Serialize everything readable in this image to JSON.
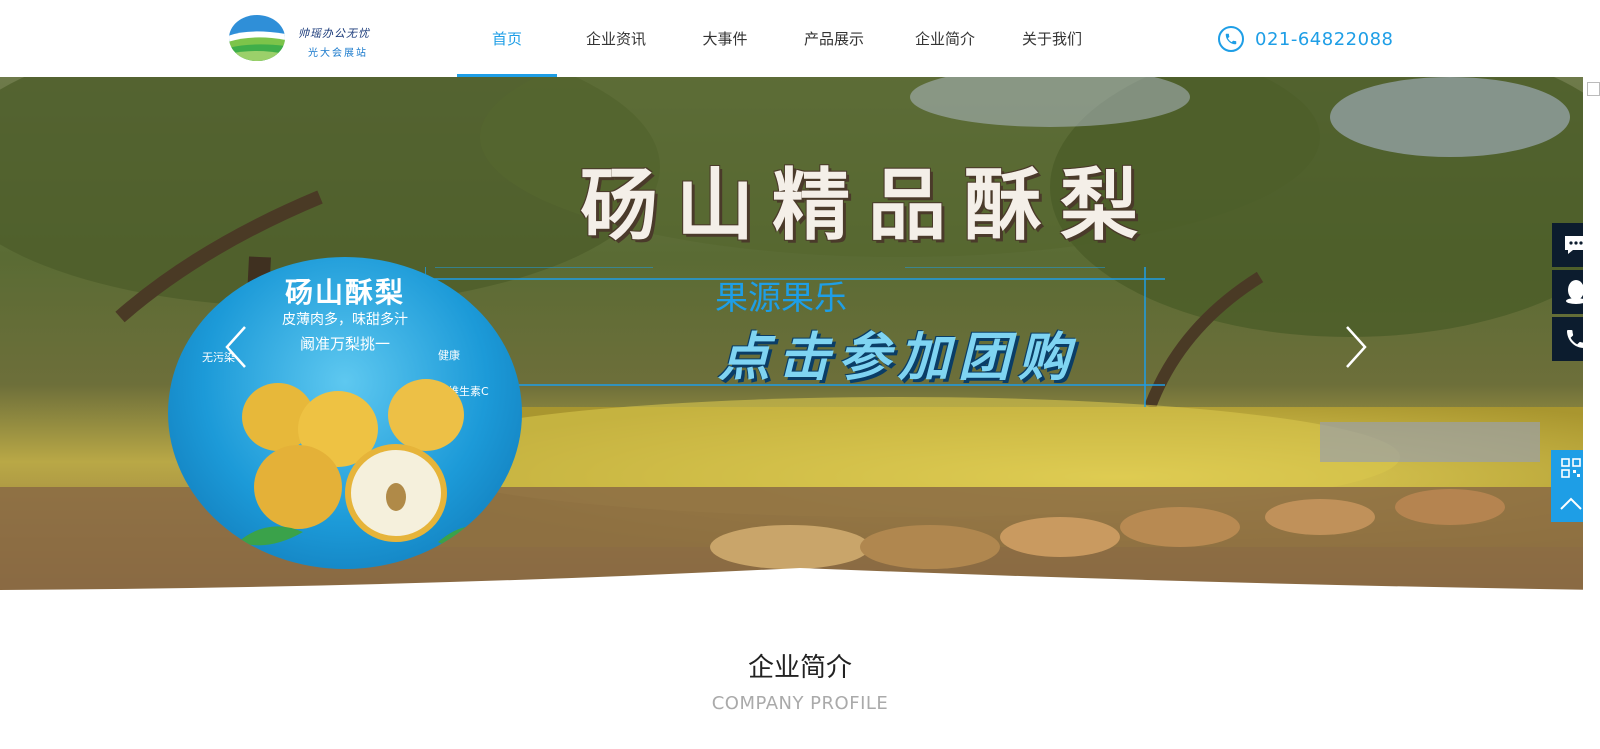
{
  "header": {
    "logo": {
      "line1": "帅瑶办公无忧",
      "line2": "光大会展站",
      "icon": "logo-hills-icon"
    },
    "nav": [
      {
        "label": "首页",
        "active": true
      },
      {
        "label": "企业资讯",
        "active": false
      },
      {
        "label": "大事件",
        "active": false
      },
      {
        "label": "产品展示",
        "active": false
      },
      {
        "label": "企业简介",
        "active": false
      },
      {
        "label": "关于我们",
        "active": false
      }
    ],
    "phone": {
      "icon": "phone-icon",
      "number": "021-64822088"
    }
  },
  "banner": {
    "title": "砀山精品酥梨",
    "brand": "果源果乐",
    "cta": "点击参加团购",
    "badge": {
      "title": "砀山酥梨",
      "subtitle": "皮薄肉多，味甜多汁",
      "slogan": "阚准万梨挑一",
      "tags": [
        "无污染",
        "健康",
        "维生素C"
      ]
    },
    "prev_icon": "chevron-left-icon",
    "next_icon": "chevron-right-icon"
  },
  "section": {
    "title": "企业简介",
    "subtitle": "COMPANY PROFILE"
  },
  "float_bar": {
    "items": [
      "chat-icon",
      "qq-icon",
      "phone-icon"
    ],
    "qr": "qrcode-icon",
    "top": "back-to-top-icon"
  },
  "colors": {
    "accent": "#1e9ee6",
    "float_dark": "#0c1c2e"
  }
}
